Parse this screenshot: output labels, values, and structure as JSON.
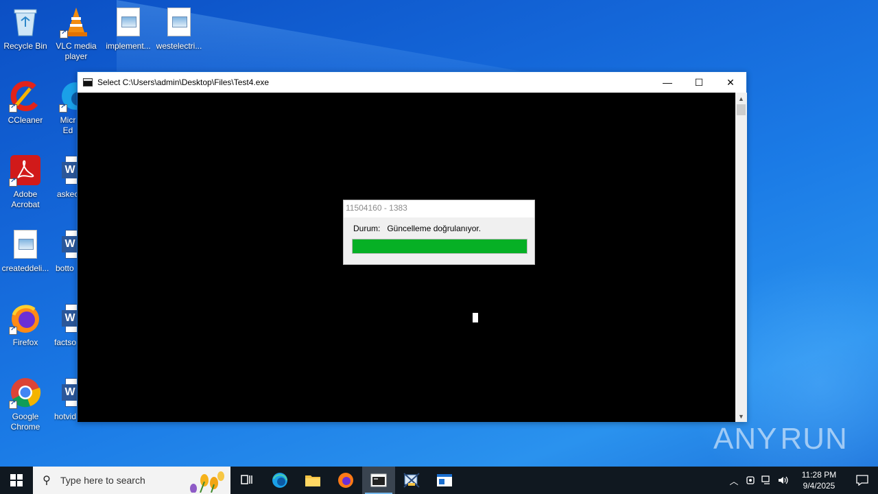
{
  "desktop": {
    "icons": [
      {
        "label": "Recycle Bin",
        "icon": "recycle-bin-icon"
      },
      {
        "label": "VLC media player",
        "icon": "vlc-icon"
      },
      {
        "label": "implement...",
        "icon": "image-file-icon"
      },
      {
        "label": "westelectri...",
        "icon": "image-file-icon"
      },
      {
        "label": "CCleaner",
        "icon": "ccleaner-icon"
      },
      {
        "label": "Micr Ed",
        "icon": "edge-icon"
      },
      {
        "label": "Adobe Acrobat",
        "icon": "acrobat-icon"
      },
      {
        "label": "askec",
        "icon": "word-doc-icon"
      },
      {
        "label": "createddeli...",
        "icon": "image-file-icon"
      },
      {
        "label": "botto",
        "icon": "word-doc-icon"
      },
      {
        "label": "Firefox",
        "icon": "firefox-icon"
      },
      {
        "label": "factso",
        "icon": "word-doc-icon"
      },
      {
        "label": "Google Chrome",
        "icon": "chrome-icon"
      },
      {
        "label": "hotvid",
        "icon": "word-doc-icon"
      }
    ]
  },
  "window": {
    "title": "Select C:\\Users\\admin\\Desktop\\Files\\Test4.exe",
    "minimize": "—",
    "maximize": "☐",
    "close": "✕"
  },
  "dialog": {
    "title": "11504160 - 1383",
    "status_label": "Durum:",
    "status_text": "Güncelleme doğrulanıyor.",
    "progress_percent": 100,
    "progress_color": "#06b025"
  },
  "watermark": {
    "left": "ANY",
    "right": "RUN"
  },
  "taskbar": {
    "search_placeholder": "Type here to search",
    "clock_time": "11:28 PM",
    "clock_date": "9/4/2025"
  },
  "colors": {
    "taskbar": "#101820",
    "accent": "#76b9ed"
  }
}
